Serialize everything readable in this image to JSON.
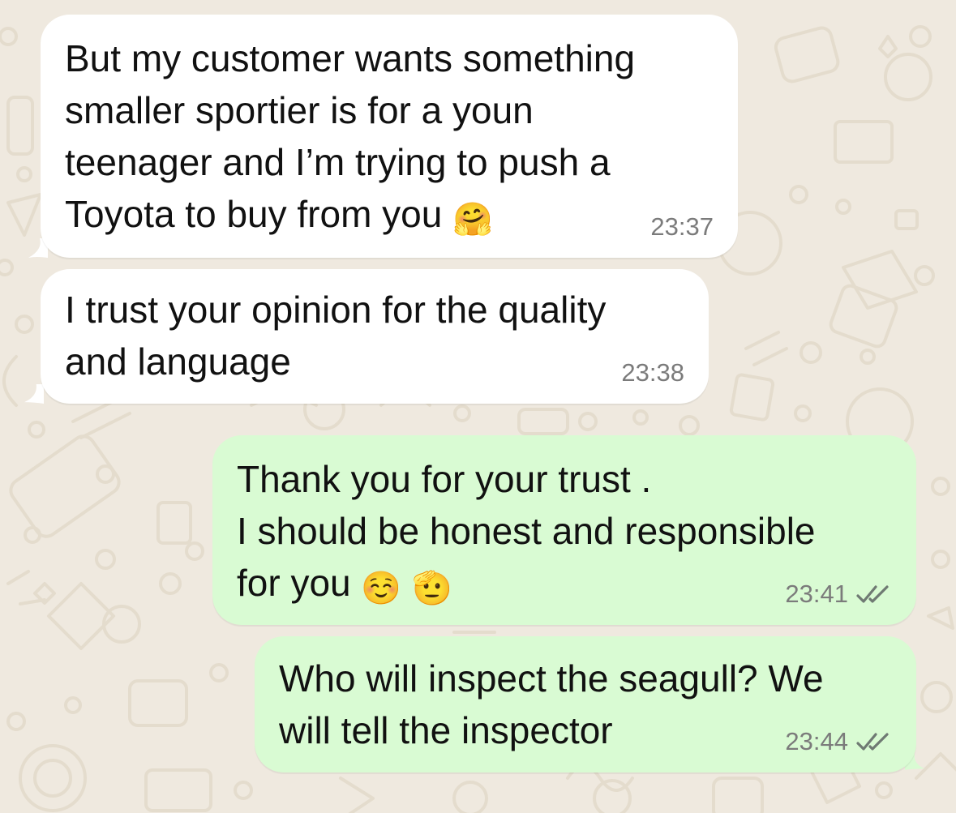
{
  "conversation": {
    "messages": [
      {
        "direction": "incoming",
        "text": "But my customer wants something\nsmaller sportier is for a youn\nteenager and I’m trying to push a\nToyota to buy from you",
        "emoji": "🤗",
        "emoji_icon": "hugging-face-emoji",
        "time": "23:37"
      },
      {
        "direction": "incoming",
        "text": "I trust your opinion for the quality\nand language",
        "time": "23:38"
      },
      {
        "direction": "outgoing",
        "text": "Thank you for your trust .\nI should be honest and responsible\nfor you",
        "emoji": "☺️ 🫡",
        "emoji_icon": "smiling-face-and-saluting-face-emoji",
        "time": "23:41",
        "status": "read",
        "status_icon": "double-check-icon"
      },
      {
        "direction": "outgoing",
        "text": "Who will inspect the seagull? We\nwill tell the inspector",
        "time": "23:44",
        "status": "read",
        "status_icon": "double-check-icon"
      }
    ]
  },
  "theme": {
    "wallpaper": "#efe9df",
    "wallpaper_doodle": "#e4dccd",
    "incoming_bubble": "#ffffff",
    "outgoing_bubble": "#d9fbd3",
    "timestamp": "#7b7b7b",
    "read_tick": "#6f7a73"
  }
}
